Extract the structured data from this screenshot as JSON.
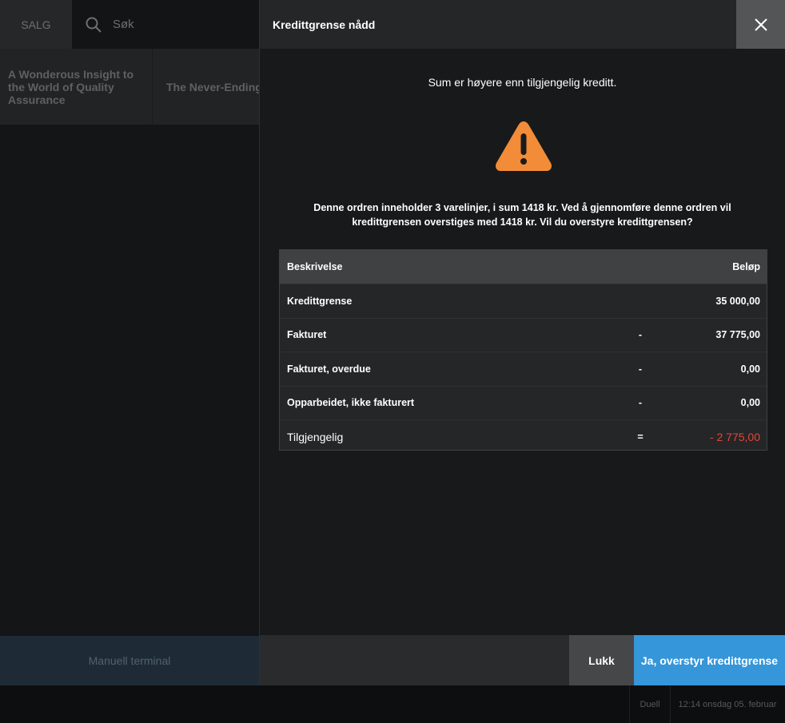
{
  "background": {
    "tab_label": "SALG",
    "search_placeholder": "Søk",
    "products": [
      "A Wonderous Insight to the World of Quality Assurance",
      "The Never-Ending"
    ],
    "terminal_label": "Manuell terminal",
    "status_user": "Duell",
    "status_time": "12:14 onsdag 05. februar"
  },
  "modal": {
    "title": "Kredittgrense nådd",
    "headline": "Sum er høyere enn tilgjengelig kreditt.",
    "message": "Denne ordren inneholder 3 varelinjer, i sum 1418 kr. Ved å gjennomføre denne ordren vil kredittgrensen overstiges med 1418 kr. Vil du overstyre kredittgrensen?",
    "warning_icon": "warning-triangle-icon",
    "warning_color": "#f28c38",
    "table": {
      "header_desc": "Beskrivelse",
      "header_amount": "Beløp",
      "rows": [
        {
          "desc": "Kredittgrense",
          "op": "",
          "amount": "35 000,00"
        },
        {
          "desc": "Fakturet",
          "op": "-",
          "amount": "37 775,00"
        },
        {
          "desc": "Fakturet, overdue",
          "op": "-",
          "amount": "0,00"
        },
        {
          "desc": "Opparbeidet, ikke fakturert",
          "op": "-",
          "amount": "0,00"
        }
      ],
      "total": {
        "desc": "Tilgjengelig",
        "op": "=",
        "amount": "- 2 775,00"
      },
      "negative_color": "#e2473a"
    },
    "buttons": {
      "close": "Lukk",
      "override": "Ja, overstyr kredittgrense"
    },
    "accent_color": "#3596d9"
  }
}
